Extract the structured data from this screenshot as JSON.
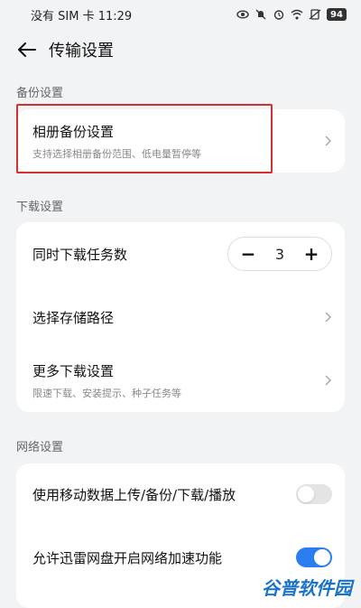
{
  "status_bar": {
    "carrier_time": "没有 SIM 卡 11:29",
    "battery": "94"
  },
  "header": {
    "title": "传输设置"
  },
  "backup_section": {
    "title": "备份设置",
    "album_backup": {
      "label": "相册备份设置",
      "sub": "支持选择相册备份范围、低电量暂停等"
    }
  },
  "download_section": {
    "title": "下载设置",
    "concurrent": {
      "label": "同时下载任务数",
      "minus": "−",
      "value": "3",
      "plus": "+"
    },
    "storage_path": {
      "label": "选择存储路径"
    },
    "more": {
      "label": "更多下载设置",
      "sub": "限速下载、安装提示、种子任务等"
    }
  },
  "network_section": {
    "title": "网络设置",
    "mobile_data": {
      "label": "使用移动数据上传/备份/下载/播放",
      "enabled": false
    },
    "acceleration": {
      "label": "允许迅雷网盘开启网络加速功能",
      "enabled": true
    }
  },
  "watermark": "谷普软件园",
  "colors": {
    "accent": "#2a7ef0",
    "highlight": "#d62f2f",
    "background": "#f2f3f5"
  }
}
